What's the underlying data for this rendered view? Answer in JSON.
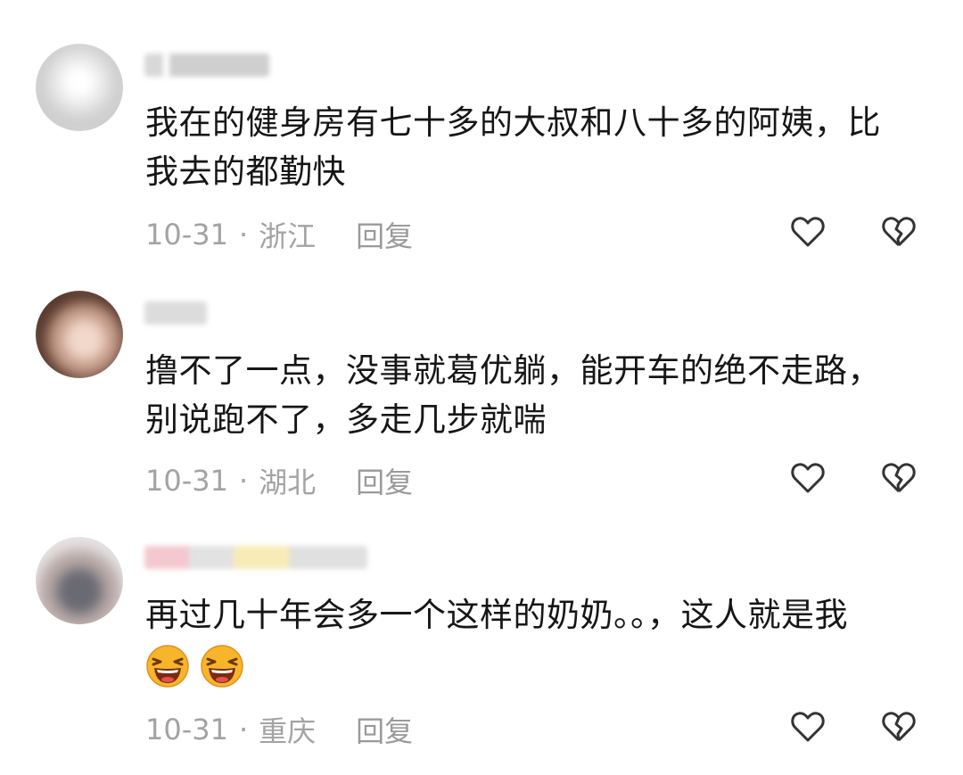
{
  "comments": [
    {
      "text": "我在的健身房有七十多的大叔和八十多的阿姨，比\n我去的都勤快",
      "date": "10-31",
      "separator": "·",
      "location": "浙江",
      "reply_label": "回复",
      "like_icon": "heart-outline-icon",
      "dislike_icon": "broken-heart-icon"
    },
    {
      "text": "撸不了一点，没事就葛优躺，能开车的绝不走路，\n别说跑不了，多走几步就喘",
      "date": "10-31",
      "separator": "·",
      "location": "湖北",
      "reply_label": "回复",
      "like_icon": "heart-outline-icon",
      "dislike_icon": "broken-heart-icon"
    },
    {
      "text": "再过几十年会多一个这样的奶奶。。，这人就是我",
      "emojis": [
        "laughing-emoji",
        "laughing-emoji"
      ],
      "date": "10-31",
      "separator": "·",
      "location": "重庆",
      "reply_label": "回复",
      "like_icon": "heart-outline-icon",
      "dislike_icon": "broken-heart-icon"
    }
  ],
  "colors": {
    "text": "#161616",
    "meta": "#a3a3a3",
    "icon": "#333333",
    "emoji_face": "#f7b52b"
  }
}
